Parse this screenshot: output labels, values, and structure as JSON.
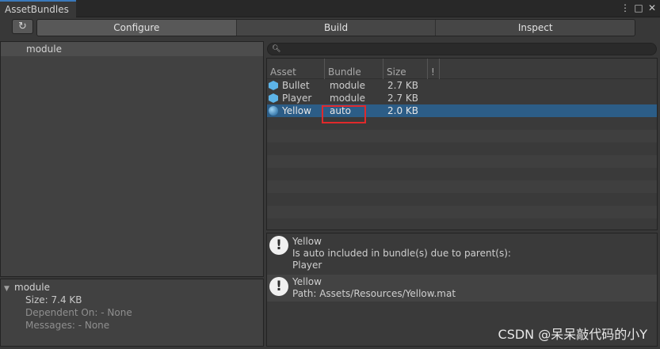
{
  "window": {
    "tab_title": "AssetBundles",
    "controls": [
      "⋮",
      "□",
      "✕"
    ]
  },
  "toolbar": {
    "refresh_icon": "↻",
    "tabs": [
      "Configure",
      "Build",
      "Inspect"
    ]
  },
  "tree": {
    "items": [
      "module"
    ]
  },
  "details": {
    "title": "module",
    "size": "Size: 7.4 KB",
    "dependent": "Dependent On: - None",
    "messages": "Messages: - None"
  },
  "search": {
    "icon": "search-icon",
    "placeholder": ""
  },
  "table": {
    "columns": [
      "Asset",
      "Bundle",
      "Size",
      "!"
    ],
    "rows": [
      {
        "asset": "Bullet",
        "bundle": "module",
        "size": "2.7 KB",
        "icon": "prefab-icon"
      },
      {
        "asset": "Player",
        "bundle": "module",
        "size": "2.7 KB",
        "icon": "prefab-icon"
      },
      {
        "asset": "Yellow",
        "bundle": "auto",
        "size": "2.0 KB",
        "icon": "material-icon",
        "selected": true
      }
    ]
  },
  "messages": [
    {
      "title": "Yellow",
      "lines": [
        "Is auto included in bundle(s) due to parent(s):",
        "Player"
      ]
    },
    {
      "title": "Yellow",
      "lines": [
        "Path: Assets/Resources/Yellow.mat"
      ]
    }
  ],
  "watermark": "CSDN @呆呆敲代码的小Y",
  "colors": {
    "selection": "#2c5d87",
    "highlight_box": "#e0292b",
    "tab_accent": "#3a79bb"
  }
}
